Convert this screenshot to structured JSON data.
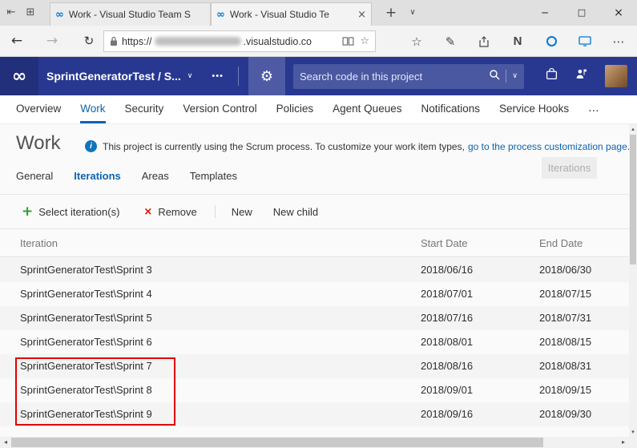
{
  "browser": {
    "titlebar": {
      "set_aside_icon": "⇤",
      "show_set_aside_icon": "⊞",
      "new_tab": "+",
      "tab_chevron": "∨",
      "minimize": "─",
      "maximize": "□",
      "close": "×"
    },
    "tabs": [
      {
        "favicon": "∞",
        "title": "Work - Visual Studio Team S"
      },
      {
        "favicon": "∞",
        "title": "Work - Visual Studio Te",
        "close": "×"
      }
    ],
    "toolbar": {
      "back": "←",
      "forward": "→",
      "refresh": "↻",
      "url_protocol": "https://",
      "url_suffix": ".visualstudio.co",
      "favorite_star": "☆",
      "hub": "☆",
      "web_note": "✎",
      "onenote": "N",
      "more": "⋯"
    }
  },
  "vsts": {
    "logo": "∞",
    "project_selector": "SprintGeneratorTest / S...",
    "selector_chevron": "∨",
    "ellipsis": "•••",
    "gear": "⚙",
    "search_placeholder": "Search code in this project",
    "search_chevron": "∨",
    "nav": [
      {
        "label": "Overview"
      },
      {
        "label": "Work"
      },
      {
        "label": "Security"
      },
      {
        "label": "Version Control"
      },
      {
        "label": "Policies"
      },
      {
        "label": "Agent Queues"
      },
      {
        "label": "Notifications"
      },
      {
        "label": "Service Hooks"
      },
      {
        "label": "…"
      }
    ]
  },
  "page": {
    "title": "Work",
    "info": {
      "icon": "i",
      "text": "This project is currently using the Scrum process. To customize your work item types,",
      "link": "go to the process customization page."
    },
    "subtabs": [
      {
        "label": "General"
      },
      {
        "label": "Iterations"
      },
      {
        "label": "Areas"
      },
      {
        "label": "Templates"
      }
    ],
    "ghost_button": "Iterations",
    "toolbar": {
      "select_icon": "+",
      "select_label": "Select iteration(s)",
      "remove_icon": "×",
      "remove_label": "Remove",
      "new_label": "New",
      "new_child_label": "New child"
    },
    "table": {
      "headers": {
        "iteration": "Iteration",
        "start": "Start Date",
        "end": "End Date"
      },
      "rows": [
        {
          "iteration": "SprintGeneratorTest\\Sprint 3",
          "start": "2018/06/16",
          "end": "2018/06/30"
        },
        {
          "iteration": "SprintGeneratorTest\\Sprint 4",
          "start": "2018/07/01",
          "end": "2018/07/15"
        },
        {
          "iteration": "SprintGeneratorTest\\Sprint 5",
          "start": "2018/07/16",
          "end": "2018/07/31"
        },
        {
          "iteration": "SprintGeneratorTest\\Sprint 6",
          "start": "2018/08/01",
          "end": "2018/08/15"
        },
        {
          "iteration": "SprintGeneratorTest\\Sprint 7",
          "start": "2018/08/16",
          "end": "2018/08/31"
        },
        {
          "iteration": "SprintGeneratorTest\\Sprint 8",
          "start": "2018/09/01",
          "end": "2018/09/15"
        },
        {
          "iteration": "SprintGeneratorTest\\Sprint 9",
          "start": "2018/09/16",
          "end": "2018/09/30"
        }
      ]
    }
  },
  "colors": {
    "header_blue": "#283891",
    "accent_blue": "#0C64B0",
    "link_blue": "#0C64B0",
    "plus_green": "#2F9E2F",
    "remove_red": "#DA0A00",
    "annotation_red": "#E10000",
    "onenote_purple": "#7719AA",
    "cortana_blue": "#0078D7"
  },
  "scrollbars": {
    "up": "▴",
    "down": "▾",
    "left": "◂",
    "right": "▸"
  }
}
